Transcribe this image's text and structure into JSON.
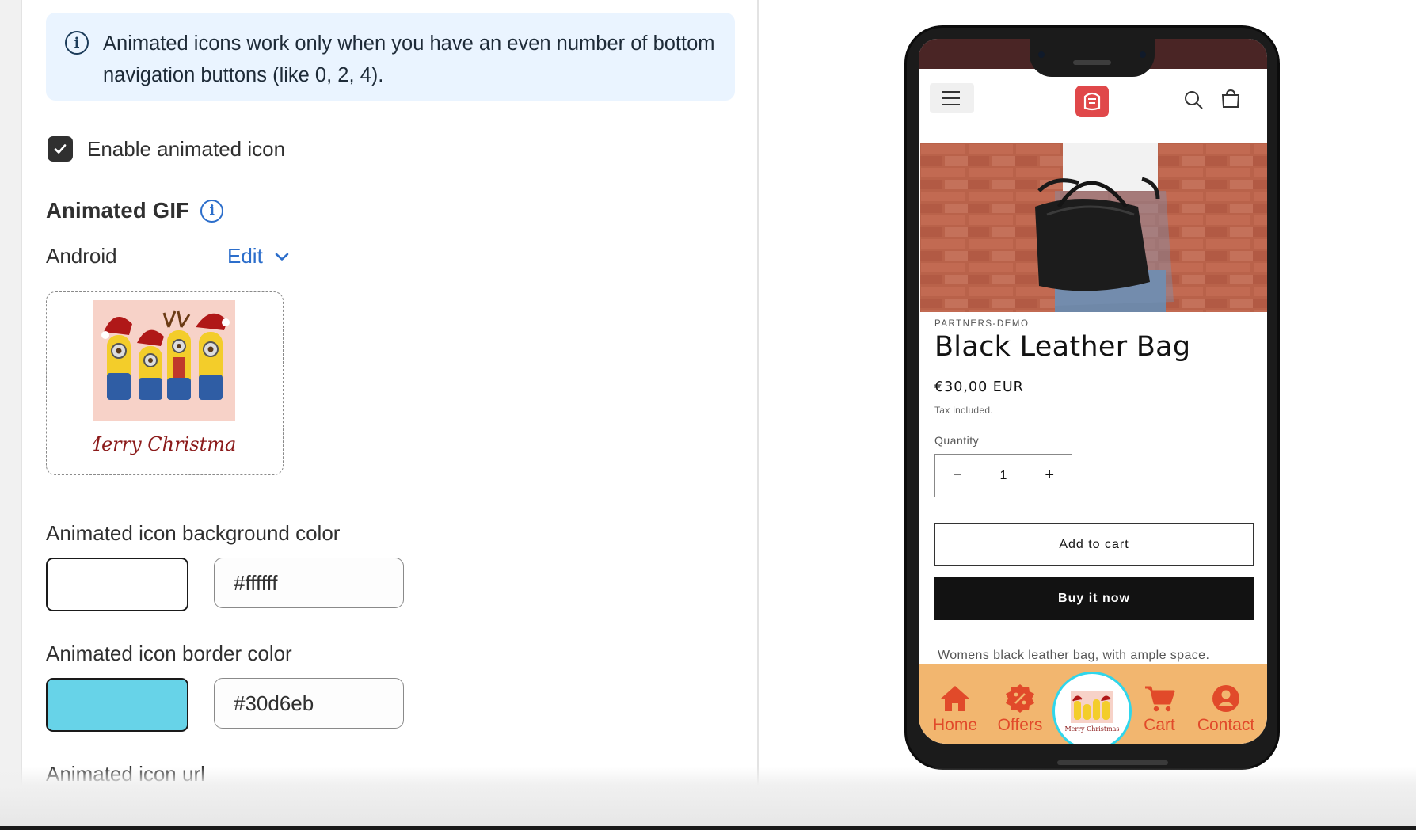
{
  "info_banner": {
    "text": "Animated icons work only when you have an even number of bottom navigation buttons (like 0, 2, 4)."
  },
  "enable_checkbox": {
    "label": "Enable animated icon",
    "checked": true
  },
  "animated_gif": {
    "title": "Animated GIF",
    "platform": "Android",
    "edit_label": "Edit",
    "gif_caption": "Merry Christmas"
  },
  "bg_color": {
    "label": "Animated icon background color",
    "hex": "#ffffff"
  },
  "border_color": {
    "label": "Animated icon border color",
    "hex": "#30d6eb"
  },
  "url_field": {
    "label": "Animated icon url",
    "value": "/"
  },
  "phone": {
    "vendor": "PARTNERS-DEMO",
    "product_title": "Black Leather Bag",
    "price": "€30,00 EUR",
    "tax_note": "Tax included.",
    "quantity_label": "Quantity",
    "quantity": "1",
    "minus": "−",
    "plus": "+",
    "add_to_cart": "Add to cart",
    "buy_now": "Buy it now",
    "description": "Womens black leather bag, with ample space.",
    "nav_bg": "#f2b66f",
    "nav_accent": "#e14a2a",
    "nav": {
      "home": "Home",
      "offers": "Offers",
      "center_caption": "Merry Christmas",
      "cart": "Cart",
      "contact": "Contact"
    }
  }
}
